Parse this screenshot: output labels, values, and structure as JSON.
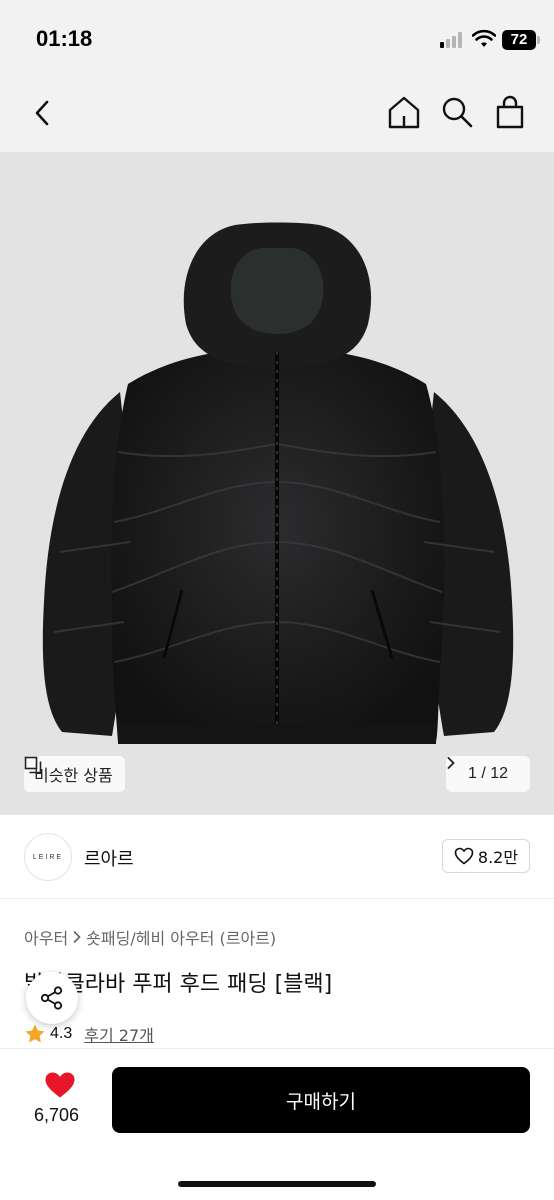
{
  "status_bar": {
    "time": "01:18",
    "battery": "72"
  },
  "nav": {
    "back": "chevron-left-icon",
    "home": "home-icon",
    "search": "search-icon",
    "bag": "shopping-bag-icon"
  },
  "gallery": {
    "similar_label": "비슷한 상품",
    "page_counter": "1 / 12"
  },
  "brand": {
    "logo_text": "LEIRE",
    "name": "르아르",
    "likes": "8.2만"
  },
  "breadcrumb": {
    "category": "아우터",
    "subcategory": "숏패딩/헤비 아우터 (르아르)"
  },
  "product": {
    "title": "발라클라바 푸퍼 후드 패딩 [블랙]",
    "rating": "4.3",
    "reviews": "후기 27개"
  },
  "bottom": {
    "wish_count": "6,706",
    "buy_label": "구매하기"
  },
  "colors": {
    "accent_red": "#e8162b",
    "star": "#f5a623",
    "buy_bg": "#000000"
  }
}
